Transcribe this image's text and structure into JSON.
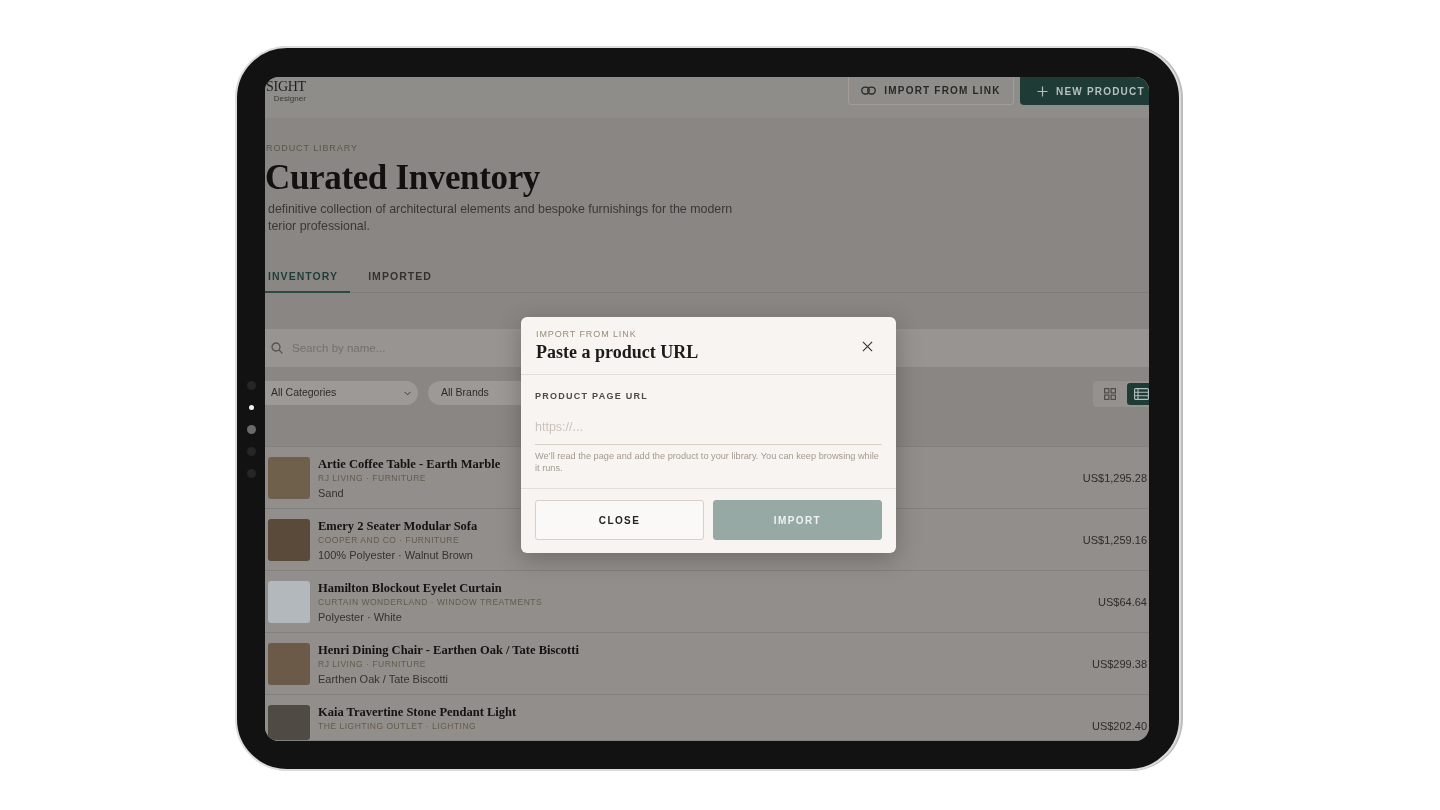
{
  "device": {
    "page_indicator": [
      {
        "selected": false
      },
      {
        "selected": true
      },
      {
        "selected": false
      },
      {
        "selected": false
      },
      {
        "selected": false
      }
    ]
  },
  "header": {
    "logo": {
      "wordmark": "SIGHT",
      "tagline": "Designer"
    },
    "actions": [
      {
        "kind": "outline",
        "label": "IMPORT FROM LINK"
      },
      {
        "kind": "primary",
        "label": "NEW PRODUCT"
      }
    ]
  },
  "intro": {
    "eyebrow": "RODUCT LIBRARY",
    "title": "Curated Inventory",
    "description": "definitive collection of architectural elements and bespoke furnishings for the modern terior professional."
  },
  "tabs": [
    {
      "label": "INVENTORY",
      "selected": true
    },
    {
      "label": "IMPORTED",
      "selected": false
    }
  ],
  "search": {
    "placeholder": "Search by name..."
  },
  "filters": [
    {
      "value": "All Categories"
    },
    {
      "value": "All Brands"
    }
  ],
  "view_toggle": [
    {
      "kind": "grid",
      "selected": false
    },
    {
      "kind": "list",
      "selected": true
    }
  ],
  "products": [
    {
      "name": "Artie Coffee Table - Earth Marble",
      "meta": "RJ LIVING · FURNITURE",
      "details": "Sand",
      "price": "US$1,295.28"
    },
    {
      "name": "Emery 2 Seater Modular Sofa",
      "meta": "COOPER AND CO · FURNITURE",
      "details": "100% Polyester · Walnut Brown",
      "price": "US$1,259.16"
    },
    {
      "name": "Hamilton Blockout Eyelet Curtain",
      "meta": "CURTAIN WONDERLAND · WINDOW TREATMENTS",
      "details": "Polyester · White",
      "price": "US$64.64"
    },
    {
      "name": "Henri Dining Chair - Earthen Oak / Tate Biscotti",
      "meta": "RJ LIVING · FURNITURE",
      "details": "Earthen Oak / Tate Biscotti",
      "price": "US$299.38"
    },
    {
      "name": "Kaia Travertine Stone Pendant Light",
      "meta": "THE LIGHTING OUTLET · LIGHTING",
      "price": "US$202.40"
    }
  ],
  "dialog": {
    "eyebrow": "IMPORT FROM LINK",
    "title": "Paste a product URL",
    "field": {
      "label": "PRODUCT PAGE URL",
      "placeholder": "https://...",
      "help": "We’ll read the page and add the product to your library. You can keep browsing while it runs."
    },
    "buttons": [
      {
        "kind": "secondary",
        "label": "CLOSE",
        "disabled": false
      },
      {
        "kind": "primary",
        "label": "IMPORT",
        "disabled": true
      }
    ]
  }
}
